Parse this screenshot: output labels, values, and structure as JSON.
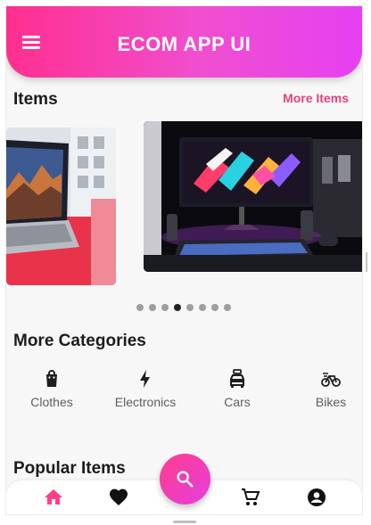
{
  "app_bar": {
    "title": "ECOM APP UI",
    "menu_icon": "menu-icon"
  },
  "items_section": {
    "title": "Items",
    "more_label": "More Items"
  },
  "carousel": {
    "slide_count": 8,
    "active_index": 3,
    "slides": [
      "laptop-photo",
      "gaming-setup-photo"
    ]
  },
  "categories_section": {
    "title": "More Categories",
    "items": [
      {
        "label": "Clothes",
        "icon": "shopping-bag-icon"
      },
      {
        "label": "Electronics",
        "icon": "lightning-bolt-icon"
      },
      {
        "label": "Cars",
        "icon": "car-icon"
      },
      {
        "label": "Bikes",
        "icon": "bike-icon"
      }
    ]
  },
  "popular_section": {
    "title": "Popular Items"
  },
  "bottom_nav": {
    "items": [
      "home-icon",
      "heart-icon",
      "search-icon",
      "cart-icon",
      "account-icon"
    ],
    "active": "home-icon"
  },
  "colors": {
    "gradient_start": "#ff2f8f",
    "gradient_end": "#e63ff2",
    "accent": "#ec3f7a",
    "active_nav": "#ff3f86"
  }
}
